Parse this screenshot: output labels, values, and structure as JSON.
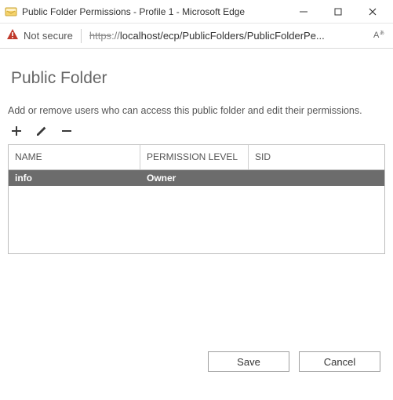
{
  "window": {
    "title": "Public Folder Permissions - Profile 1 - Microsoft Edge"
  },
  "addressbar": {
    "not_secure_label": "Not secure",
    "url_scheme": "https",
    "url_sep": "://",
    "url_host_path": "localhost/ecp/PublicFolders/PublicFolderPe...",
    "read_aloud_label": "Aあ"
  },
  "page": {
    "title": "Public Folder",
    "intro": "Add or remove users who can access this public folder and edit their permissions."
  },
  "toolbar": {
    "add_label": "Add",
    "edit_label": "Edit",
    "remove_label": "Remove"
  },
  "grid": {
    "columns": {
      "name": "NAME",
      "permission": "PERMISSION LEVEL",
      "sid": "SID"
    },
    "rows": [
      {
        "name": "info",
        "permission": "Owner",
        "sid": "",
        "selected": true
      }
    ]
  },
  "buttons": {
    "save": "Save",
    "cancel": "Cancel"
  }
}
